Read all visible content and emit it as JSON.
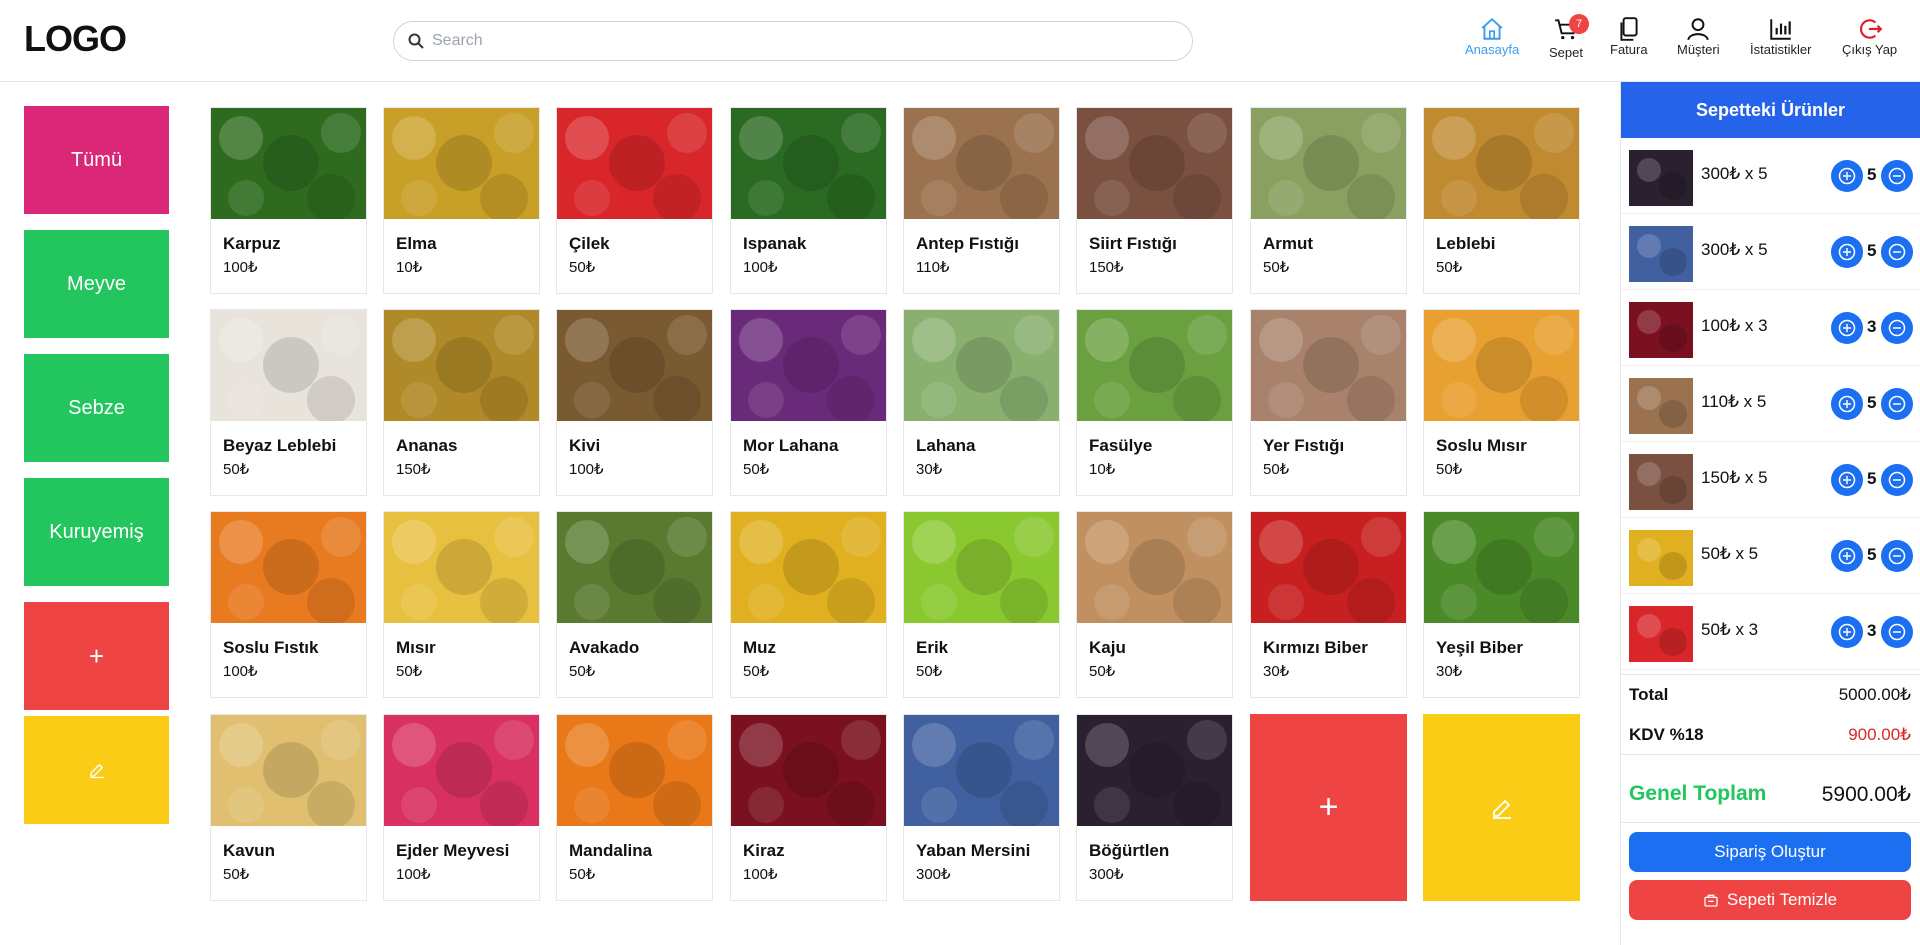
{
  "header": {
    "logo": "LOGO",
    "search_placeholder": "Search",
    "nav": [
      {
        "label": "Anasayfa",
        "icon": "home-icon"
      },
      {
        "label": "Sepet",
        "icon": "cart-icon",
        "badge": "7"
      },
      {
        "label": "Fatura",
        "icon": "invoice-icon"
      },
      {
        "label": "Müşteri",
        "icon": "user-icon"
      },
      {
        "label": "İstatistikler",
        "icon": "stats-icon"
      },
      {
        "label": "Çıkış Yap",
        "icon": "logout-icon"
      }
    ]
  },
  "categories": [
    {
      "label": "Tümü",
      "color": "#db2777"
    },
    {
      "label": "Meyve",
      "color": "#22c55e"
    },
    {
      "label": "Sebze",
      "color": "#22c55e"
    },
    {
      "label": "Kuruyemiş",
      "color": "#22c55e"
    },
    {
      "label": "+",
      "color": "#ef4444"
    },
    {
      "label": "",
      "color": "#facc15",
      "icon": "edit-icon"
    }
  ],
  "products": [
    {
      "name": "Karpuz",
      "price": "100₺"
    },
    {
      "name": "Elma",
      "price": "10₺"
    },
    {
      "name": "Çilek",
      "price": "50₺"
    },
    {
      "name": "Ispanak",
      "price": "100₺"
    },
    {
      "name": "Antep Fıstığı",
      "price": "110₺"
    },
    {
      "name": "Siirt Fıstığı",
      "price": "150₺"
    },
    {
      "name": "Armut",
      "price": "50₺"
    },
    {
      "name": "Leblebi",
      "price": "50₺"
    },
    {
      "name": "Beyaz Leblebi",
      "price": "50₺"
    },
    {
      "name": "Ananas",
      "price": "150₺"
    },
    {
      "name": "Kivi",
      "price": "100₺"
    },
    {
      "name": "Mor Lahana",
      "price": "50₺"
    },
    {
      "name": "Lahana",
      "price": "30₺"
    },
    {
      "name": "Fasülye",
      "price": "10₺"
    },
    {
      "name": "Yer Fıstığı",
      "price": "50₺"
    },
    {
      "name": "Soslu Mısır",
      "price": "50₺"
    },
    {
      "name": "Soslu Fıstık",
      "price": "100₺"
    },
    {
      "name": "Mısır",
      "price": "50₺"
    },
    {
      "name": "Avakado",
      "price": "50₺"
    },
    {
      "name": "Muz",
      "price": "50₺"
    },
    {
      "name": "Erik",
      "price": "50₺"
    },
    {
      "name": "Kaju",
      "price": "50₺"
    },
    {
      "name": "Kırmızı Biber",
      "price": "30₺"
    },
    {
      "name": "Yeşil Biber",
      "price": "30₺"
    },
    {
      "name": "Kavun",
      "price": "50₺"
    },
    {
      "name": "Ejder Meyvesi",
      "price": "100₺"
    },
    {
      "name": "Mandalina",
      "price": "50₺"
    },
    {
      "name": "Kiraz",
      "price": "100₺"
    },
    {
      "name": "Yaban Mersini",
      "price": "300₺"
    },
    {
      "name": "Böğürtlen",
      "price": "300₺"
    }
  ],
  "product_colors": [
    "#2e6b1f",
    "#c8a028",
    "#d8262a",
    "#2a6a22",
    "#9a7250",
    "#7a5040",
    "#8aa060",
    "#c08a30",
    "#e8e4dc",
    "#b08a28",
    "#7a5a30",
    "#6a2a7a",
    "#8ab070",
    "#6aa040",
    "#a8826a",
    "#e8a030",
    "#e87a20",
    "#e8c040",
    "#5a7a30",
    "#e0b020",
    "#8ac830",
    "#c09060",
    "#c82020",
    "#4a8a28",
    "#e0c070",
    "#d83060",
    "#e87818",
    "#7a1020",
    "#4060a0",
    "#2a2030"
  ],
  "grid_tiles": [
    {
      "label": "+",
      "color": "#ef4444"
    },
    {
      "label": "",
      "color": "#facc15",
      "icon": "edit-icon"
    }
  ],
  "cart": {
    "title": "Sepetteki Ürünler",
    "items": [
      {
        "text": "300₺ x 5",
        "qty": "5",
        "color": "#2a2030"
      },
      {
        "text": "300₺ x 5",
        "qty": "5",
        "color": "#4060a0"
      },
      {
        "text": "100₺ x 3",
        "qty": "3",
        "color": "#7a1020"
      },
      {
        "text": "110₺ x 5",
        "qty": "5",
        "color": "#9a7250"
      },
      {
        "text": "150₺ x 5",
        "qty": "5",
        "color": "#7a5040"
      },
      {
        "text": "50₺ x 5",
        "qty": "5",
        "color": "#e0b020"
      },
      {
        "text": "50₺ x 3",
        "qty": "3",
        "color": "#d8262a"
      }
    ],
    "total_label": "Total",
    "total_value": "5000.00₺",
    "kdv_label": "KDV %18",
    "kdv_value": "900.00₺",
    "grand_label": "Genel Toplam",
    "grand_value": "5900.00₺",
    "order_button": "Sipariş Oluştur",
    "clear_button": "Sepeti Temizle"
  },
  "colors": {
    "primary": "#2563eb",
    "accent_green": "#22c55e",
    "danger": "#ef4444",
    "warning": "#facc15",
    "pink": "#db2777"
  }
}
